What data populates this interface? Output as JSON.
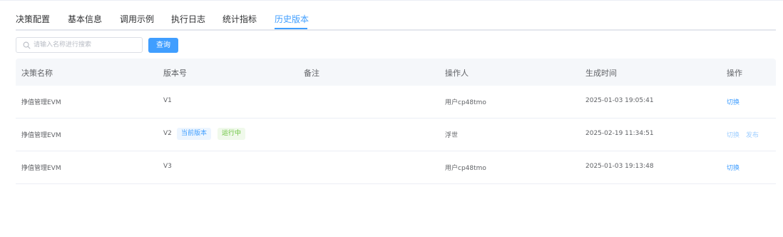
{
  "tabs": [
    {
      "label": "决策配置"
    },
    {
      "label": "基本信息"
    },
    {
      "label": "调用示例"
    },
    {
      "label": "执行日志"
    },
    {
      "label": "统计指标"
    },
    {
      "label": "历史版本",
      "active": true
    }
  ],
  "search": {
    "placeholder": "请输入名称进行搜索",
    "value": "",
    "icon": "search-icon"
  },
  "query_button": {
    "label": "查询"
  },
  "table": {
    "columns": [
      "决策名称",
      "版本号",
      "备注",
      "操作人",
      "生成时间",
      "操作"
    ],
    "rows": [
      {
        "name": "挣值管理EVM",
        "version": "V1",
        "remark": "",
        "operator": "用户cp48tmo",
        "time": "2025-01-03 19:05:41",
        "actions": [
          "切换"
        ]
      },
      {
        "name": "挣值管理EVM",
        "version": "V2",
        "tags": [
          "当前版本",
          "运行中"
        ],
        "remark": "",
        "operator": "浮世",
        "time": "2025-02-19 11:34:51",
        "actions": [
          "切换",
          "发布"
        ]
      },
      {
        "name": "挣值管理EVM",
        "version": "V3",
        "remark": "",
        "operator": "用户cp48tmo",
        "time": "2025-01-03 19:13:48",
        "actions": [
          "切换"
        ]
      }
    ]
  },
  "colors": {
    "primary": "#409eff",
    "primary_light": "#a0cfff",
    "success": "#67c23a",
    "text": "#606266",
    "header_bg": "#f5f7fa",
    "border": "#ebeef5"
  }
}
